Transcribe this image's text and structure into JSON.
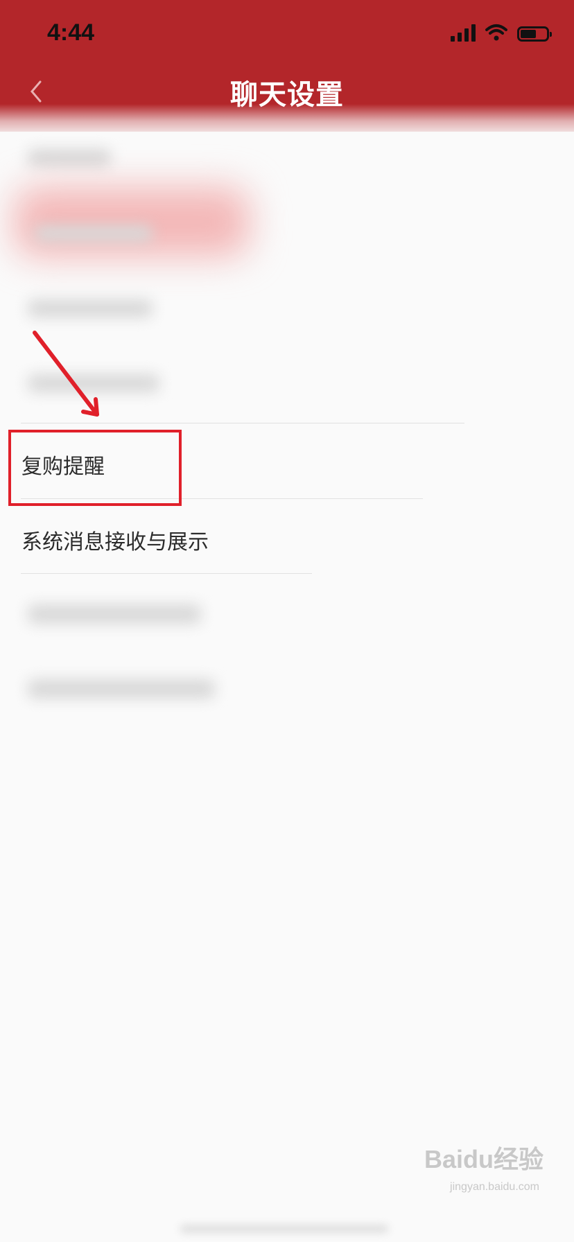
{
  "status_bar": {
    "time": "4:44"
  },
  "header": {
    "title": "聊天设置"
  },
  "list": {
    "items": [
      {
        "label": "复购提醒"
      },
      {
        "label": "系统消息接收与展示"
      }
    ]
  },
  "watermark": {
    "brand": "Baidu经验",
    "url": "jingyan.baidu.com"
  },
  "colors": {
    "header_bg": "#b3262a",
    "highlight": "#e0202a"
  },
  "icons": {
    "back": "chevron-left-icon",
    "signal": "signal-icon",
    "wifi": "wifi-icon",
    "battery": "battery-icon"
  }
}
